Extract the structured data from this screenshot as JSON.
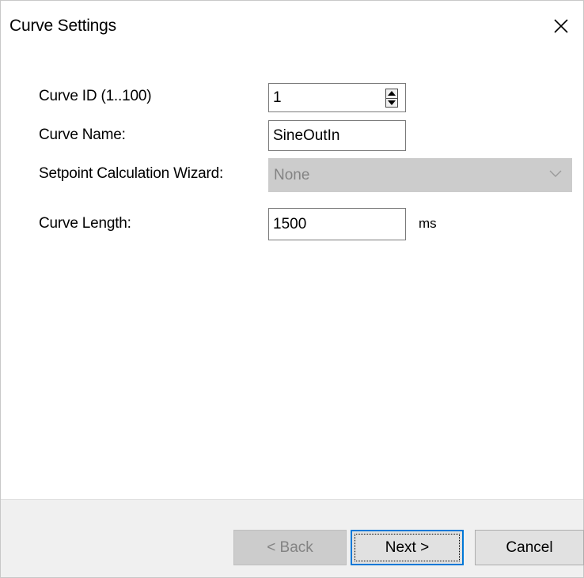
{
  "dialog": {
    "title": "Curve Settings",
    "close_icon": "close-icon"
  },
  "form": {
    "curve_id": {
      "label": "Curve ID (1..100)",
      "value": "1"
    },
    "curve_name": {
      "label": "Curve Name:",
      "value": "SineOutIn"
    },
    "wizard": {
      "label": "Setpoint Calculation Wizard:",
      "value": "None",
      "disabled": true
    },
    "curve_length": {
      "label": "Curve Length:",
      "value": "1500",
      "unit": "ms"
    }
  },
  "buttons": {
    "back": "< Back",
    "next": "Next >",
    "cancel": "Cancel"
  },
  "colors": {
    "focus_border": "#0078d7",
    "footer_bg": "#f0f0f0",
    "disabled_bg": "#cccccc"
  }
}
